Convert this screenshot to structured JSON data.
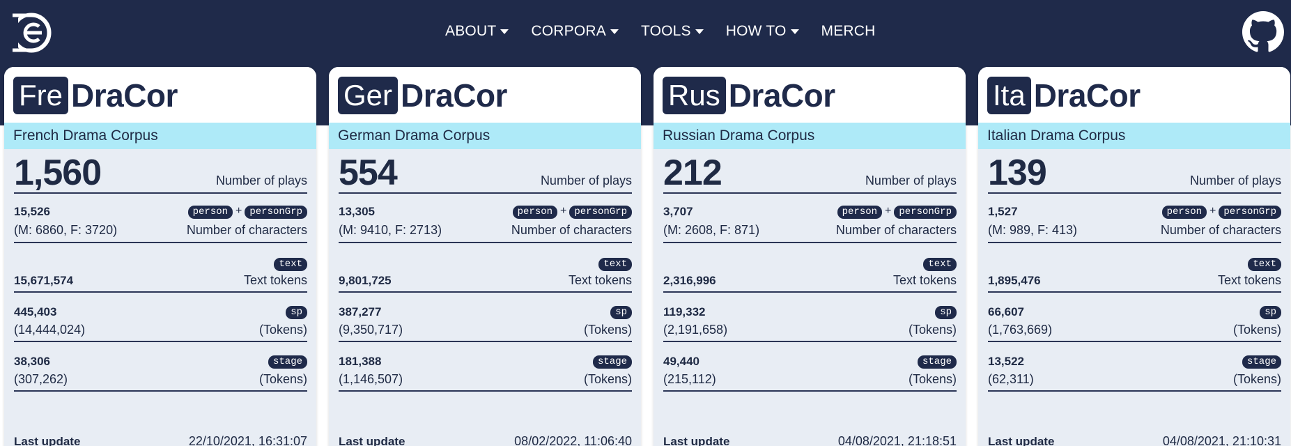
{
  "nav": {
    "items": [
      {
        "label": "ABOUT",
        "dropdown": true
      },
      {
        "label": "CORPORA",
        "dropdown": true
      },
      {
        "label": "TOOLS",
        "dropdown": true
      },
      {
        "label": "HOW TO",
        "dropdown": true
      },
      {
        "label": "MERCH",
        "dropdown": false
      }
    ],
    "logo_icon": "dracor-logo-icon",
    "github_icon": "github-icon"
  },
  "tags": {
    "person": "person",
    "personGrp": "personGrp",
    "plus": "+",
    "text": "text",
    "sp": "sp",
    "stage": "stage"
  },
  "labels": {
    "plays": "Number of plays",
    "characters": "Number of characters",
    "text_tokens": "Text tokens",
    "tokens": "(Tokens)",
    "last_update": "Last update"
  },
  "corpora": [
    {
      "code": "Fre",
      "name": "DraCor",
      "title": "French Drama Corpus",
      "plays": "1,560",
      "characters": "15,526",
      "gender": "(M: 6860, F: 3720)",
      "text_tokens": "15,671,574",
      "sp": "445,403",
      "sp_tokens": "(14,444,024)",
      "stage": "38,306",
      "stage_tokens": "(307,262)",
      "updated": "22/10/2021, 16:31:07"
    },
    {
      "code": "Ger",
      "name": "DraCor",
      "title": "German Drama Corpus",
      "plays": "554",
      "characters": "13,305",
      "gender": "(M: 9410, F: 2713)",
      "text_tokens": "9,801,725",
      "sp": "387,277",
      "sp_tokens": "(9,350,717)",
      "stage": "181,388",
      "stage_tokens": "(1,146,507)",
      "updated": "08/02/2022, 11:06:40"
    },
    {
      "code": "Rus",
      "name": "DraCor",
      "title": "Russian Drama Corpus",
      "plays": "212",
      "characters": "3,707",
      "gender": "(M: 2608, F: 871)",
      "text_tokens": "2,316,996",
      "sp": "119,332",
      "sp_tokens": "(2,191,658)",
      "stage": "49,440",
      "stage_tokens": "(215,112)",
      "updated": "04/08/2021, 21:18:51"
    },
    {
      "code": "Ita",
      "name": "DraCor",
      "title": "Italian Drama Corpus",
      "plays": "139",
      "characters": "1,527",
      "gender": "(M: 989, F: 413)",
      "text_tokens": "1,895,476",
      "sp": "66,607",
      "sp_tokens": "(1,763,669)",
      "stage": "13,522",
      "stage_tokens": "(62,311)",
      "updated": "04/08/2021, 21:10:31"
    }
  ]
}
